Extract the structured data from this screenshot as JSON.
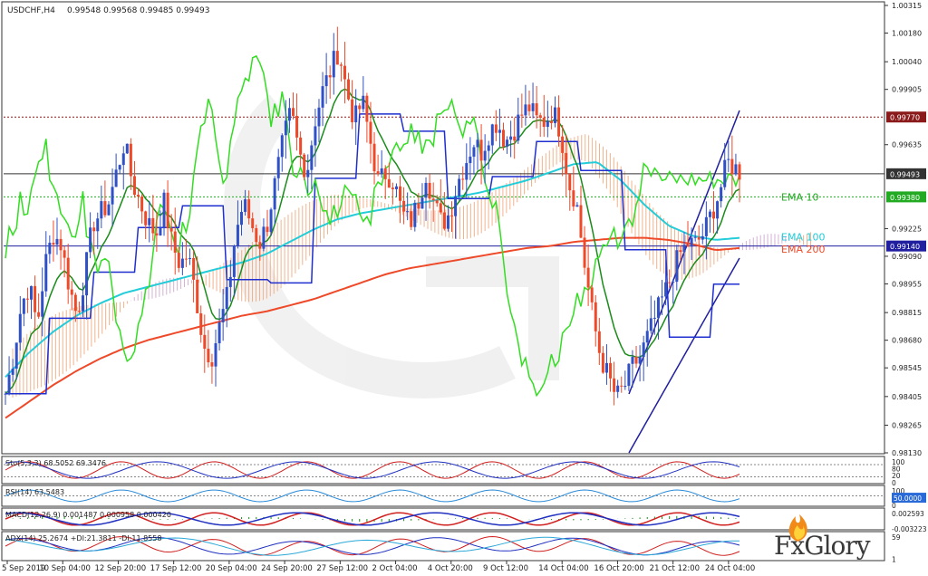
{
  "header": {
    "symbol": "USDCHF,H4",
    "ohlc": "0.99548 0.99568 0.99485 0.99493"
  },
  "brand": {
    "name": "FxGlory"
  },
  "colors": {
    "bull": "#3050c8",
    "bear": "#ee4a2a",
    "ema10": "#1a8c1a",
    "ema100": "#22ccd8",
    "ema200": "#ee4a2a",
    "kijun": "#1f2fd0",
    "chikou": "#33dd22",
    "cloud": "#f0a070",
    "channel": "#1f1fa0"
  },
  "chart_data": [
    {
      "type": "candlestick",
      "title": "USDCHF,H4",
      "ylim": [
        0.9813,
        1.00315
      ],
      "y_ticks": [
        "1.00315",
        "1.00180",
        "1.00040",
        "0.99905",
        "0.99770",
        "0.99635",
        "0.99493",
        "0.99380",
        "0.99225",
        "0.99140",
        "0.99090",
        "0.98955",
        "0.98815",
        "0.98680",
        "0.98545",
        "0.98405",
        "0.98265",
        "0.98130"
      ],
      "x_ticks": [
        "5 Sep 2019",
        "10 Sep 04:00",
        "12 Sep 20:00",
        "17 Sep 12:00",
        "20 Sep 04:00",
        "24 Sep 20:00",
        "27 Sep 12:00",
        "2 Oct 04:00",
        "4 Oct 20:00",
        "9 Oct 12:00",
        "14 Oct 04:00",
        "16 Oct 20:00",
        "21 Oct 12:00",
        "24 Oct 04:00"
      ],
      "close_path": [
        0.9842,
        0.986,
        0.9885,
        0.9895,
        0.9875,
        0.9905,
        0.992,
        0.9915,
        0.9895,
        0.988,
        0.99,
        0.9925,
        0.993,
        0.9935,
        0.995,
        0.9965,
        0.9945,
        0.9935,
        0.9925,
        0.992,
        0.9935,
        0.9915,
        0.9905,
        0.991,
        0.989,
        0.9865,
        0.986,
        0.9875,
        0.989,
        0.992,
        0.9935,
        0.9925,
        0.9915,
        0.9925,
        0.9945,
        0.9965,
        0.998,
        0.996,
        0.995,
        0.9975,
        0.999,
        1.0,
        1.001,
        0.999,
        0.9975,
        0.9985,
        0.9965,
        0.9945,
        0.995,
        0.9945,
        0.993,
        0.9925,
        0.9935,
        0.995,
        0.9935,
        0.9925,
        0.993,
        0.9945,
        0.9955,
        0.9965,
        0.996,
        0.997,
        0.9975,
        0.9965,
        0.997,
        0.9978,
        0.9982,
        0.9975,
        0.9975,
        0.998,
        0.997,
        0.9945,
        0.9935,
        0.9905,
        0.988,
        0.986,
        0.985,
        0.984,
        0.9845,
        0.9855,
        0.986,
        0.987,
        0.988,
        0.989,
        0.99,
        0.991,
        0.9915,
        0.9915,
        0.992,
        0.993,
        0.994,
        0.9955,
        0.9952,
        0.9949
      ],
      "levels": [
        {
          "label": "0.99770",
          "value": 0.9977,
          "style": "dotted",
          "color": "#8b1a1a"
        },
        {
          "label": "0.99493",
          "value": 0.99493,
          "style": "solid",
          "color": "#333333"
        },
        {
          "label": "0.99380",
          "value": 0.9938,
          "style": "dotted",
          "color": "#22aa22"
        },
        {
          "label": "0.99140",
          "value": 0.9914,
          "style": "solid",
          "color": "#1f1fa0"
        }
      ],
      "indicator_labels": [
        {
          "name": "EMA 10",
          "value": 0.9938,
          "color": "#22aa22"
        },
        {
          "name": "EMA 100",
          "value": 0.99185,
          "color": "#22ccd8"
        },
        {
          "name": "EMA 200",
          "value": 0.99125,
          "color": "#ee4a2a"
        }
      ],
      "ema200": [
        0.983,
        0.9838,
        0.9846,
        0.9853,
        0.9859,
        0.9864,
        0.9868,
        0.9871,
        0.9874,
        0.9877,
        0.988,
        0.9882,
        0.9885,
        0.9888,
        0.9892,
        0.9896,
        0.99,
        0.9903,
        0.9905,
        0.9907,
        0.9909,
        0.9911,
        0.9913,
        0.9914,
        0.9916,
        0.9917,
        0.9918,
        0.9918,
        0.9917,
        0.9915,
        0.9912,
        0.9913
      ],
      "ema100": [
        0.985,
        0.9862,
        0.9872,
        0.988,
        0.9886,
        0.9891,
        0.9894,
        0.9897,
        0.99,
        0.9903,
        0.9906,
        0.991,
        0.9916,
        0.9922,
        0.9927,
        0.993,
        0.9932,
        0.9934,
        0.9936,
        0.9938,
        0.994,
        0.9943,
        0.9946,
        0.995,
        0.9954,
        0.9955,
        0.9946,
        0.9934,
        0.9924,
        0.9919,
        0.9917,
        0.9918
      ]
    },
    {
      "type": "line",
      "title": "Sto(5,3,3) 68.5052 69.3476",
      "y_ticks": [
        "100",
        "80",
        "20",
        "0"
      ]
    },
    {
      "type": "line",
      "title": "RSI(14) 63.5483",
      "y_ticks": [
        "100",
        "50.0000",
        "0"
      ]
    },
    {
      "type": "bar",
      "title": "MACD(12,26,9) 0.001487 0.000958 0.000420",
      "y_ticks": [
        "0.002593",
        "-0.003223"
      ]
    },
    {
      "type": "line",
      "title": "ADX(14) 25.2674 +DI:21.3811 -DI:11.8558",
      "y_ticks": [
        "59",
        "1"
      ]
    }
  ]
}
